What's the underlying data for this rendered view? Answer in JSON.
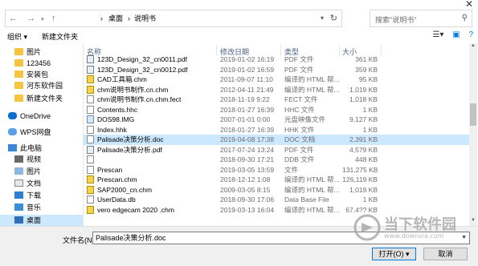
{
  "window": {
    "close_glyph": "✕"
  },
  "address": {
    "back_glyph": "←",
    "forward_glyph": "→",
    "up_glyph": "↑",
    "crumbs": [
      "桌面",
      "说明书"
    ],
    "separator": "›"
  },
  "search": {
    "placeholder": "搜索\"说明书\""
  },
  "toolbar": {
    "organize": "组织 ▾",
    "new_folder": "新建文件夹"
  },
  "sidebar": {
    "items": [
      {
        "label": "图片",
        "icon": "folder-icon",
        "selected": false
      },
      {
        "label": "123456",
        "icon": "folder-icon",
        "selected": false
      },
      {
        "label": "安装包",
        "icon": "folder-icon",
        "selected": false
      },
      {
        "label": "河东软件园",
        "icon": "folder-icon",
        "selected": false
      },
      {
        "label": "新建文件夹",
        "icon": "folder-icon",
        "selected": false
      },
      {
        "label": "OneDrive",
        "icon": "cloud-icon",
        "selected": false
      },
      {
        "label": "WPS网盘",
        "icon": "cloud-icon",
        "selected": false
      },
      {
        "label": "此电脑",
        "icon": "computer-icon",
        "selected": false
      },
      {
        "label": "视频",
        "icon": "video-icon",
        "selected": false
      },
      {
        "label": "图片",
        "icon": "picture-icon",
        "selected": false
      },
      {
        "label": "文档",
        "icon": "document-icon",
        "selected": false
      },
      {
        "label": "下载",
        "icon": "download-icon",
        "selected": false
      },
      {
        "label": "音乐",
        "icon": "music-icon",
        "selected": false
      },
      {
        "label": "桌面",
        "icon": "desktop-icon",
        "selected": true
      }
    ]
  },
  "table": {
    "headers": {
      "name": "名称",
      "date": "修改日期",
      "type": "类型",
      "size": "大小"
    },
    "rows": [
      {
        "name": "123D_Design_32_cn0011.pdf",
        "date": "2019-01-02 16:19",
        "type": "PDF 文件",
        "size": "361 KB",
        "icon": "pdf"
      },
      {
        "name": "123D_Design_32_cn0012.pdf",
        "date": "2019-01-02 16:59",
        "type": "PDF 文件",
        "size": "359 KB",
        "icon": "pdf"
      },
      {
        "name": "CAD工具箱.chm",
        "date": "2011-09-07 11:10",
        "type": "编译的 HTML 帮...",
        "size": "95 KB",
        "icon": "chm"
      },
      {
        "name": "chm说明书制作.cn.chm",
        "date": "2012-04-11 21:49",
        "type": "编译的 HTML 帮...",
        "size": "1,019 KB",
        "icon": "chm"
      },
      {
        "name": "chm说明书制作.cn.chm.fect",
        "date": "2018-11-19 9:22",
        "type": "FECT 文件",
        "size": "1,018 KB",
        "icon": "doc"
      },
      {
        "name": "Contents.hhc",
        "date": "2018-01-27 16:39",
        "type": "HHC 文件",
        "size": "1 KB",
        "icon": "doc"
      },
      {
        "name": "DOS98.IMG",
        "date": "2007-01-01 0:00",
        "type": "光盘映像文件",
        "size": "9,127 KB",
        "icon": "img"
      },
      {
        "name": "Index.hhk",
        "date": "2018-01-27 16:39",
        "type": "HHK 文件",
        "size": "1 KB",
        "icon": "doc"
      },
      {
        "name": "Palisade决策分析.doc",
        "date": "2019-04-08 17:38",
        "type": "DOC 文档",
        "size": "2,391 KB",
        "icon": "doc"
      },
      {
        "name": "Palisade决策分析.pdf",
        "date": "2017-07-24 13:24",
        "type": "PDF 文件",
        "size": "4,579 KB",
        "icon": "pdf"
      },
      {
        "name": "",
        "date": "2018-09-30 17:21",
        "type": "DDB 文件",
        "size": "448 KB",
        "icon": "doc"
      },
      {
        "name": "Prescan",
        "date": "2019-03-05 13:59",
        "type": "文件",
        "size": "131,275 KB",
        "icon": "doc"
      },
      {
        "name": "Prescan.chm",
        "date": "2018-12-12 1:08",
        "type": "编译的 HTML 帮...",
        "size": "126,119 KB",
        "icon": "chm"
      },
      {
        "name": "SAP2000_cn.chm",
        "date": "2009-03-05 8:15",
        "type": "编译的 HTML 帮...",
        "size": "1,019 KB",
        "icon": "chm"
      },
      {
        "name": "UserData.db",
        "date": "2018-09-30 17:06",
        "type": "Data Base File",
        "size": "1 KB",
        "icon": "doc"
      },
      {
        "name": "vero edgecam 2020 .chm",
        "date": "2019-03-13 16:04",
        "type": "编译的 HTML 帮...",
        "size": "67,4?? KB",
        "icon": "chm"
      }
    ],
    "selected_index": 8
  },
  "bottom": {
    "filename_label": "文件名(N):",
    "filename_value": "Palisade决策分析.doc",
    "open_label": "打开(O)",
    "cancel_label": "取消"
  },
  "watermark": {
    "text": "当下软件园",
    "url": "www.downxia.com"
  }
}
